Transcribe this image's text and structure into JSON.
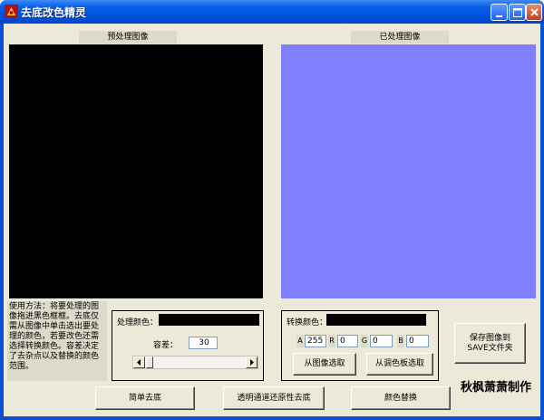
{
  "window": {
    "title": "去底改色精灵"
  },
  "panels": {
    "original_label": "预处理图像",
    "processed_label": "已处理图像",
    "original_color": "#000000",
    "processed_color": "#8080ff"
  },
  "instructions": "使用方法：将要处理的图像拖进黑色框框。去底仅需从图像中单击选出要处理的颜色，若要改色还需选择转换颜色。容差决定了去杂点以及替换的颜色范围。",
  "process_group": {
    "color_label": "处理颜色：",
    "tolerance_label": "容差：",
    "tolerance_value": "30"
  },
  "convert_group": {
    "color_label": "转换颜色：",
    "a_label": "A",
    "a_value": "255",
    "r_label": "R",
    "r_value": "0",
    "g_label": "G",
    "g_value": "0",
    "b_label": "B",
    "b_value": "0",
    "pick_from_image": "从图像选取",
    "pick_from_palette": "从调色板选取"
  },
  "buttons": {
    "save": "保存图像到SAVE文件夹",
    "simple_remove": "简单去底",
    "transparent_remove": "透明通道还原性去底",
    "color_replace": "颜色替换"
  },
  "credit": "秋枫萧萧制作"
}
